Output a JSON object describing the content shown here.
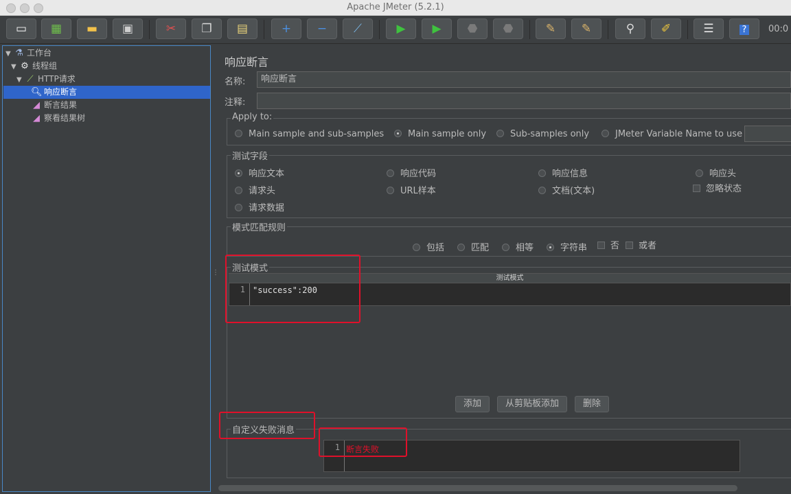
{
  "window": {
    "title": "Apache JMeter (5.2.1)"
  },
  "toolbar": {
    "icons": [
      "new-icon",
      "templates-icon",
      "open-icon",
      "save-icon",
      "cut-icon",
      "copy-icon",
      "paste-icon",
      "expand-icon",
      "collapse-icon",
      "toggle-icon",
      "start-icon",
      "start-no-pause-icon",
      "stop-icon",
      "shutdown-icon",
      "clear-icon",
      "clear-all-icon",
      "search-icon",
      "reset-search-icon",
      "function-helper-icon",
      "help-icon"
    ],
    "timer": "00:0"
  },
  "tree": {
    "items": [
      {
        "label": "工作台",
        "icon": "workbench-icon"
      },
      {
        "label": "线程组",
        "icon": "gear-icon"
      },
      {
        "label": "HTTP请求",
        "icon": "sampler-icon"
      },
      {
        "label": "响应断言",
        "icon": "assertion-icon"
      },
      {
        "label": "断言结果",
        "icon": "listener-icon"
      },
      {
        "label": "察看结果树",
        "icon": "listener-icon"
      }
    ]
  },
  "panel": {
    "title": "响应断言",
    "name_label": "名称:",
    "name_value": "响应断言",
    "comment_label": "注释:",
    "comment_value": "",
    "apply_to": {
      "title": "Apply to:",
      "options": [
        "Main sample and sub-samples",
        "Main sample only",
        "Sub-samples only",
        "JMeter Variable Name to use"
      ],
      "selected": "Main sample only",
      "variable_name": ""
    },
    "test_field": {
      "title": "测试字段",
      "options": [
        "响应文本",
        "响应代码",
        "响应信息",
        "响应头",
        "请求头",
        "URL样本",
        "文档(文本)",
        "请求数据"
      ],
      "selected": "响应文本",
      "ignore_status": "忽略状态"
    },
    "pattern_rules": {
      "title": "模式匹配规则",
      "options": [
        "包括",
        "匹配",
        "相等",
        "字符串"
      ],
      "selected": "字符串",
      "not_label": "否",
      "or_label": "或者"
    },
    "test_patterns": {
      "title": "测试模式",
      "column_header": "测试模式",
      "rows": [
        {
          "line": "1",
          "text": "\"success\":200"
        }
      ],
      "buttons": {
        "add": "添加",
        "add_clipboard": "从剪贴板添加",
        "delete": "删除"
      }
    },
    "custom_failure": {
      "title": "自定义失败消息",
      "rows": [
        {
          "line": "1",
          "text": "断言失败"
        }
      ]
    }
  },
  "colors": {
    "highlight_box": "#e0102a",
    "selection": "#2f65ca",
    "failure_text": "#e0102a"
  }
}
